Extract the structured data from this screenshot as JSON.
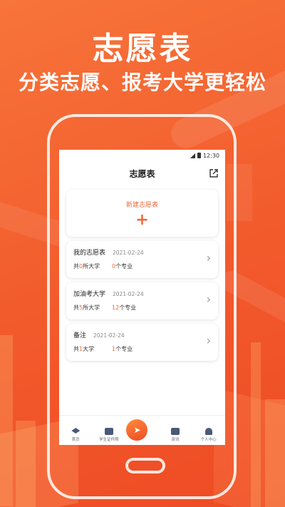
{
  "hero": {
    "title": "志愿表",
    "subtitle": "分类志愿、报考大学更轻松"
  },
  "status_bar": {
    "time": "12:30"
  },
  "nav": {
    "title": "志愿表",
    "share_icon": "share-icon"
  },
  "new_card": {
    "label": "新建志愿表",
    "icon": "plus-icon"
  },
  "items": [
    {
      "name": "我的志愿表",
      "date": "2021-02-24",
      "uni_prefix": "共",
      "uni_count": "0",
      "uni_suffix": "所大学",
      "major_count": "0",
      "major_suffix": "个专业"
    },
    {
      "name": "加油考大学",
      "date": "2021-02-24",
      "uni_prefix": "共",
      "uni_count": "5",
      "uni_suffix": "所大学",
      "major_count": "12",
      "major_suffix": "个专业"
    },
    {
      "name": "备注",
      "date": "2021-02-24",
      "uni_prefix": "共",
      "uni_count": "1",
      "uni_suffix": "大学",
      "major_count": "1",
      "major_suffix": "个专业"
    }
  ],
  "tabs": [
    {
      "label": "首页",
      "icon": "graduation-cap-icon"
    },
    {
      "label": "学生证件照",
      "icon": "id-card-icon"
    },
    {
      "label": "",
      "icon": "paper-plane-icon"
    },
    {
      "label": "资讯",
      "icon": "message-icon"
    },
    {
      "label": "个人中心",
      "icon": "person-icon"
    }
  ],
  "colors": {
    "accent": "#ef6a3a",
    "background": "#f25a2c"
  }
}
